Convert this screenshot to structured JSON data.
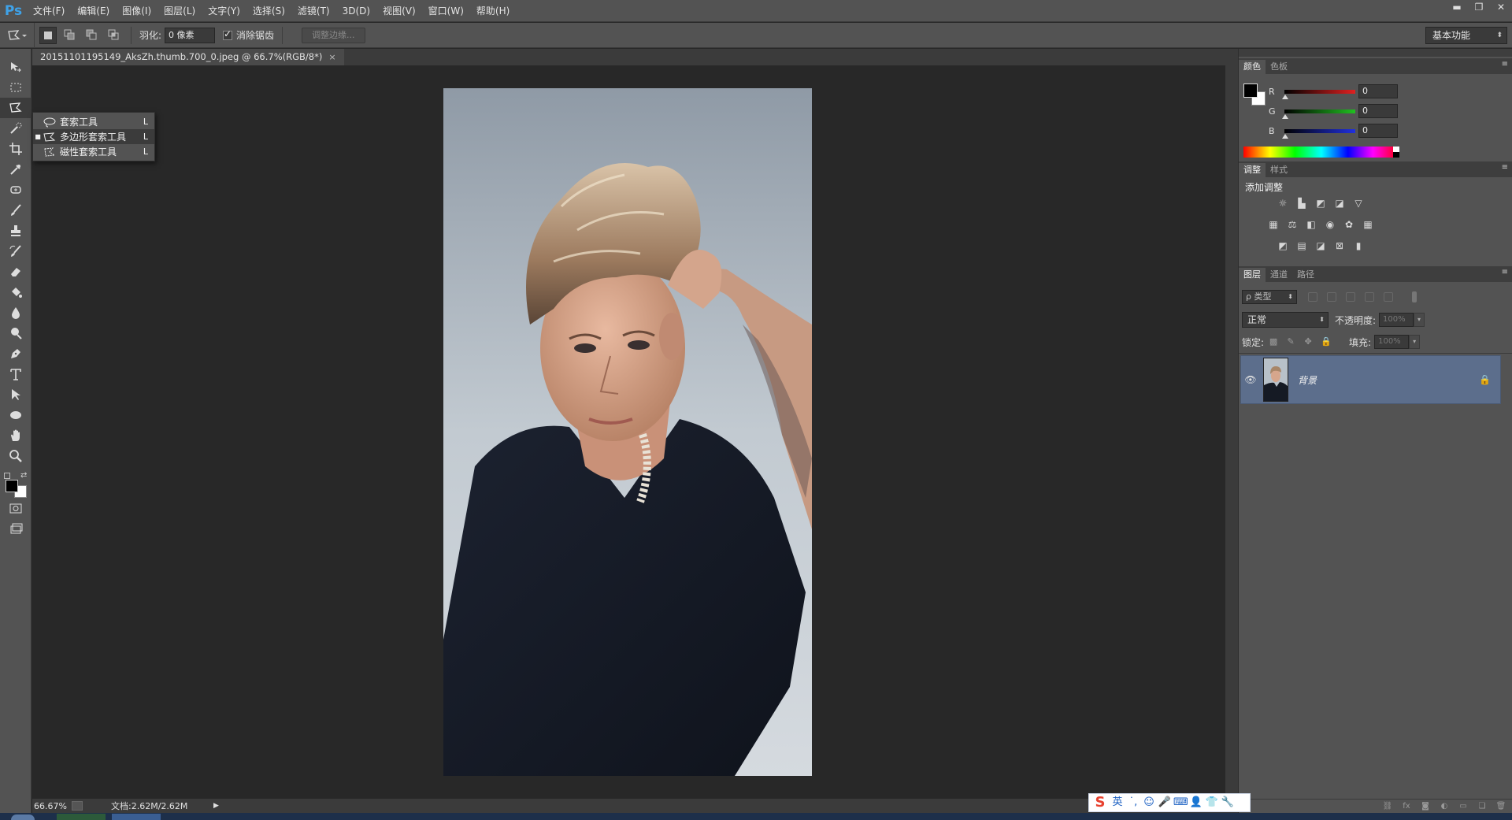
{
  "app": {
    "logo": "Ps",
    "menu": [
      "文件(F)",
      "编辑(E)",
      "图像(I)",
      "图层(L)",
      "文字(Y)",
      "选择(S)",
      "滤镜(T)",
      "3D(D)",
      "视图(V)",
      "窗口(W)",
      "帮助(H)"
    ],
    "window_controls": [
      "▬",
      "❐",
      "✕"
    ]
  },
  "options": {
    "feather_label": "羽化:",
    "feather_value": "0 像素",
    "antialias_label": "消除锯齿",
    "antialias_checked": true,
    "refine_edge_label": "调整边缘...",
    "workspace": "基本功能"
  },
  "document": {
    "tab_title": "20151101195149_AksZh.thumb.700_0.jpeg @ 66.7%(RGB/8*)",
    "close_glyph": "×"
  },
  "flyout": {
    "items": [
      {
        "label": "套索工具",
        "shortcut": "L",
        "selected": false
      },
      {
        "label": "多边形套索工具",
        "shortcut": "L",
        "selected": true
      },
      {
        "label": "磁性套索工具",
        "shortcut": "L",
        "selected": false
      }
    ]
  },
  "status": {
    "zoom": "66.67%",
    "doc_info": "文档:2.62M/2.62M"
  },
  "color_panel": {
    "tabs": [
      "颜色",
      "色板"
    ],
    "channels": [
      {
        "label": "R",
        "value": "0",
        "color": "#e02020"
      },
      {
        "label": "G",
        "value": "0",
        "color": "#20c020"
      },
      {
        "label": "B",
        "value": "0",
        "color": "#2030e0"
      }
    ],
    "foreground": "#000000",
    "background": "#ffffff"
  },
  "adjustments_panel": {
    "tabs": [
      "调整",
      "样式"
    ],
    "title": "添加调整",
    "row1_icons": [
      "brightness-icon",
      "levels-icon",
      "curves-icon",
      "exposure-icon",
      "vibrance-icon"
    ],
    "row2_icons": [
      "hue-saturation-icon",
      "color-balance-icon",
      "black-white-icon",
      "photo-filter-icon",
      "channel-mixer-icon",
      "color-lookup-icon"
    ],
    "row3_icons": [
      "invert-icon",
      "posterize-icon",
      "threshold-icon",
      "selective-color-icon",
      "gradient-map-icon"
    ]
  },
  "layers_panel": {
    "tabs": [
      "图层",
      "通道",
      "路径"
    ],
    "filter_kind": "ρ 类型",
    "blend_mode": "正常",
    "opacity_label": "不透明度:",
    "opacity_value": "100%",
    "lock_label": "锁定:",
    "fill_label": "填充:",
    "fill_value": "100%",
    "layers": [
      {
        "name": "背景",
        "visible": true,
        "locked": true
      }
    ],
    "footer_icons": [
      "link-icon",
      "fx-icon",
      "mask-icon",
      "adjustment-icon",
      "group-icon",
      "new-layer-icon",
      "delete-icon"
    ]
  },
  "ime": {
    "logo": "S",
    "lang": "英"
  }
}
